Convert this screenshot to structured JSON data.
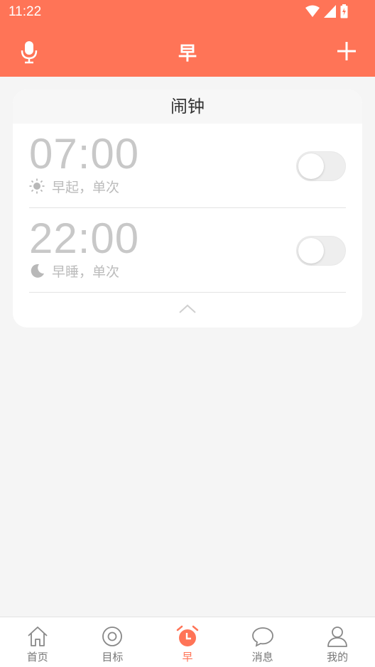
{
  "status_bar": {
    "time": "11:22"
  },
  "app_bar": {
    "title": "早",
    "left_icon": "microphone-icon",
    "right_icon": "plus-icon"
  },
  "card": {
    "header": "闹钟",
    "alarms": [
      {
        "time": "07:00",
        "icon": "sun-icon",
        "label": "早起，单次",
        "enabled": false
      },
      {
        "time": "22:00",
        "icon": "moon-icon",
        "label": "早睡，单次",
        "enabled": false
      }
    ],
    "collapse_icon": "chevron-up-icon"
  },
  "bottom_nav": {
    "items": [
      {
        "label": "首页",
        "icon": "home-icon",
        "active": false
      },
      {
        "label": "目标",
        "icon": "target-icon",
        "active": false
      },
      {
        "label": "早",
        "icon": "alarm-clock-icon",
        "active": true
      },
      {
        "label": "消息",
        "icon": "chat-bubble-icon",
        "active": false
      },
      {
        "label": "我的",
        "icon": "person-icon",
        "active": false
      }
    ]
  },
  "colors": {
    "accent": "#ff7457",
    "background": "#f5f5f5",
    "muted_text": "#c8c8c8"
  }
}
